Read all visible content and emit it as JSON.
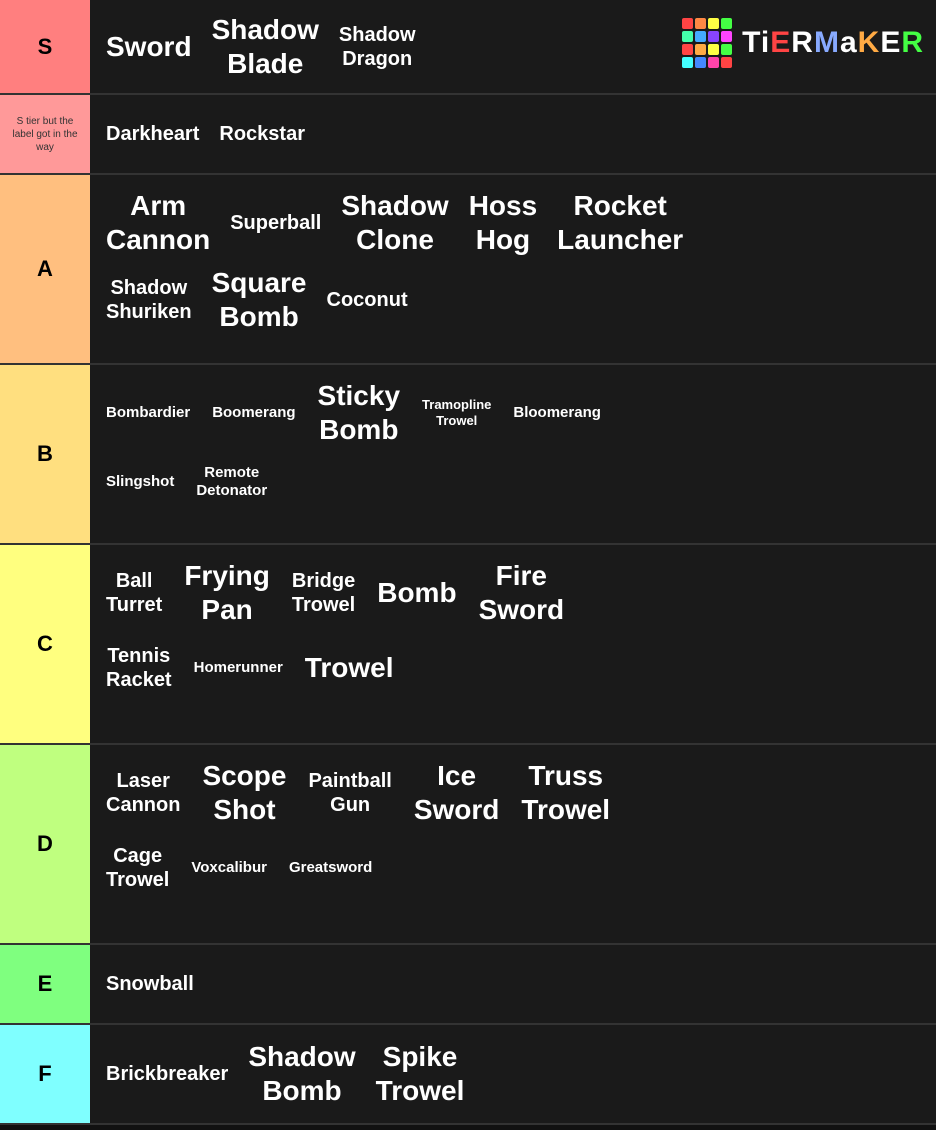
{
  "tiers": [
    {
      "id": "s",
      "label": "S",
      "labelClass": "s-bg",
      "items": [
        {
          "text": "Sword",
          "size": "large"
        },
        {
          "text": "Shadow\nBlade",
          "size": "large"
        },
        {
          "text": "Shadow\nDragon",
          "size": "medium"
        }
      ]
    },
    {
      "id": "s2",
      "label": "S tier but\nthe label\ngot in the\nway",
      "labelClass": "s2-bg",
      "labelSmall": true,
      "items": [
        {
          "text": "Darkheart",
          "size": "medium"
        },
        {
          "text": "Rockstar",
          "size": "medium"
        }
      ]
    },
    {
      "id": "a",
      "label": "A",
      "labelClass": "a-bg",
      "items": [
        {
          "text": "Arm\nCannon",
          "size": "large"
        },
        {
          "text": "Superball",
          "size": "medium"
        },
        {
          "text": "Shadow\nClone",
          "size": "large"
        },
        {
          "text": "Hoss\nHog",
          "size": "large"
        },
        {
          "text": "Rocket\nLauncher",
          "size": "large"
        },
        {
          "text": "Shadow\nShuriken",
          "size": "medium"
        },
        {
          "text": "Square\nBomb",
          "size": "large"
        },
        {
          "text": "Coconut",
          "size": "medium"
        }
      ]
    },
    {
      "id": "b",
      "label": "B",
      "labelClass": "b-bg",
      "items": [
        {
          "text": "Bombardier",
          "size": "small"
        },
        {
          "text": "Boomerang",
          "size": "small"
        },
        {
          "text": "Sticky\nBomb",
          "size": "large"
        },
        {
          "text": "Tramopline\nTrowel",
          "size": "xsmall"
        },
        {
          "text": "Bloomerang",
          "size": "small"
        },
        {
          "text": "Slingshot",
          "size": "small"
        },
        {
          "text": "Remote\nDetonator",
          "size": "small"
        }
      ]
    },
    {
      "id": "c",
      "label": "C",
      "labelClass": "c-bg",
      "items": [
        {
          "text": "Ball\nTurret",
          "size": "medium"
        },
        {
          "text": "Frying\nPan",
          "size": "large"
        },
        {
          "text": "Bridge\nTrowel",
          "size": "medium"
        },
        {
          "text": "Bomb",
          "size": "large"
        },
        {
          "text": "Fire\nSword",
          "size": "large"
        },
        {
          "text": "Tennis\nRacket",
          "size": "medium"
        },
        {
          "text": "Homerunner",
          "size": "small"
        },
        {
          "text": "Trowel",
          "size": "large"
        }
      ]
    },
    {
      "id": "d",
      "label": "D",
      "labelClass": "d-bg",
      "items": [
        {
          "text": "Laser\nCannon",
          "size": "medium"
        },
        {
          "text": "Scope\nShot",
          "size": "large"
        },
        {
          "text": "Paintball\nGun",
          "size": "medium"
        },
        {
          "text": "Ice\nSword",
          "size": "large"
        },
        {
          "text": "Truss\nTrowel",
          "size": "large"
        },
        {
          "text": "Cage\nTrowel",
          "size": "medium"
        },
        {
          "text": "Voxcalibur",
          "size": "small"
        },
        {
          "text": "Greatsword",
          "size": "small"
        }
      ]
    },
    {
      "id": "e",
      "label": "E",
      "labelClass": "e-bg",
      "items": [
        {
          "text": "Snowball",
          "size": "medium"
        }
      ]
    },
    {
      "id": "f",
      "label": "F",
      "labelClass": "f-bg",
      "items": [
        {
          "text": "Brickbreaker",
          "size": "medium"
        },
        {
          "text": "Shadow\nBomb",
          "size": "large"
        },
        {
          "text": "Spike\nTrowel",
          "size": "large"
        }
      ]
    }
  ],
  "logo": {
    "text": "TiERMaKER",
    "colors": [
      "#ff4444",
      "#ffaa44",
      "#44ff44",
      "#44aaff",
      "#ff44ff",
      "#ffff44",
      "#44ffff",
      "#ffffff",
      "#ff8844",
      "#88ff44",
      "#44ff88",
      "#4488ff",
      "#ff4488",
      "#ff4444"
    ]
  }
}
